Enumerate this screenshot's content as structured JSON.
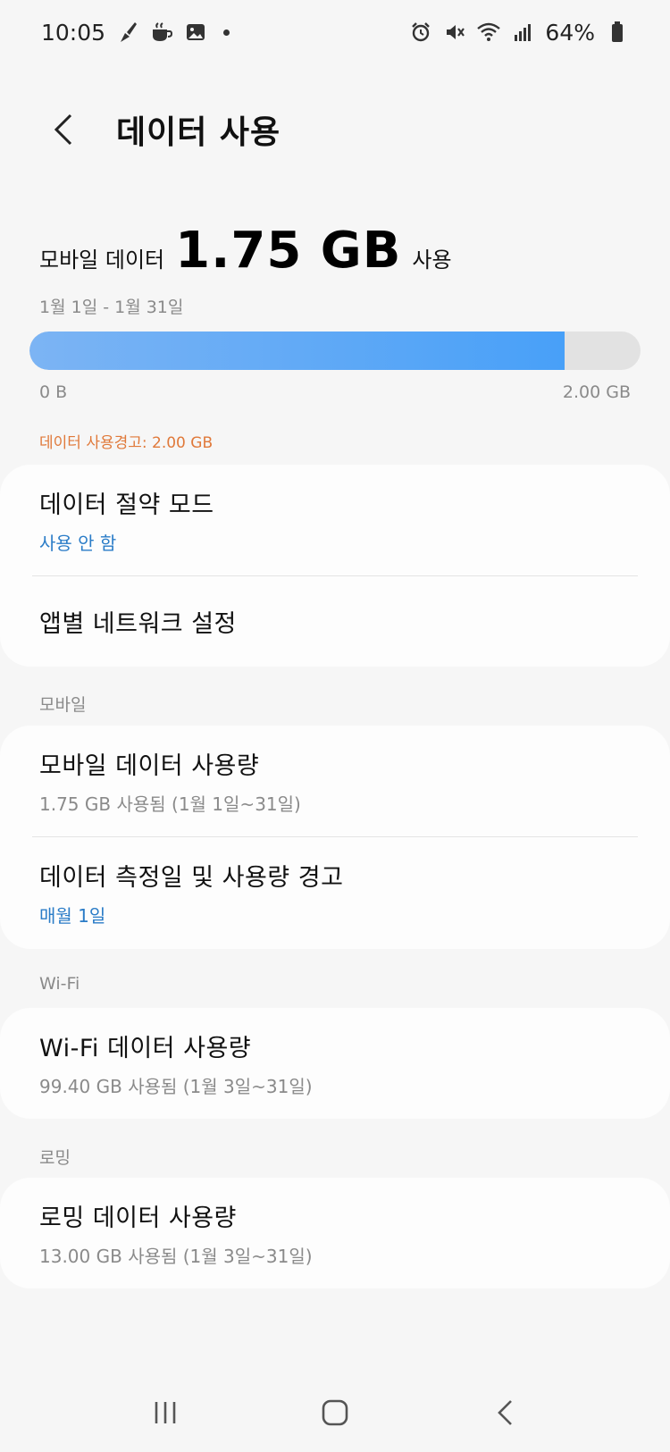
{
  "status_bar": {
    "time": "10:05",
    "battery": "64%",
    "left_icons": [
      "brush-icon",
      "coffee-icon",
      "gallery-icon"
    ],
    "right_icons": [
      "alarm-icon",
      "mute-icon",
      "wifi-icon",
      "signal-icon",
      "battery-icon"
    ]
  },
  "header": {
    "title": "데이터 사용"
  },
  "summary": {
    "prefix": "모바일 데이터",
    "amount": "1.75 GB",
    "suffix": "사용",
    "period": "1월 1일 - 1월 31일",
    "bar_min": "0 B",
    "bar_max": "2.00 GB",
    "used_fraction": 0.875,
    "warning": "데이터 사용경고: 2.00 GB",
    "colors": {
      "bar": "#48a0f8",
      "track": "#e2e2e2",
      "warning": "#e0793a"
    }
  },
  "card1": {
    "items": [
      {
        "title": "데이터 절약 모드",
        "subtitle": "사용 안 함"
      },
      {
        "title": "앱별 네트워크 설정"
      }
    ]
  },
  "mobile_section": {
    "label": "모바일",
    "items": [
      {
        "title": "모바일 데이터 사용량",
        "subtitle": "1.75 GB 사용됨 (1월 1일~31일)"
      },
      {
        "title": "데이터 측정일 및 사용량 경고",
        "subtitle": "매월 1일"
      }
    ]
  },
  "wifi_section": {
    "label": "Wi-Fi",
    "items": [
      {
        "title": "Wi-Fi 데이터 사용량",
        "subtitle": "99.40 GB 사용됨 (1월 3일~31일)"
      }
    ]
  },
  "roaming_section": {
    "label": "로밍",
    "items": [
      {
        "title": "로밍 데이터 사용량",
        "subtitle": "13.00 GB 사용됨 (1월 3일~31일)"
      }
    ]
  },
  "nav": [
    "recent-apps-icon",
    "home-icon",
    "back-icon"
  ]
}
